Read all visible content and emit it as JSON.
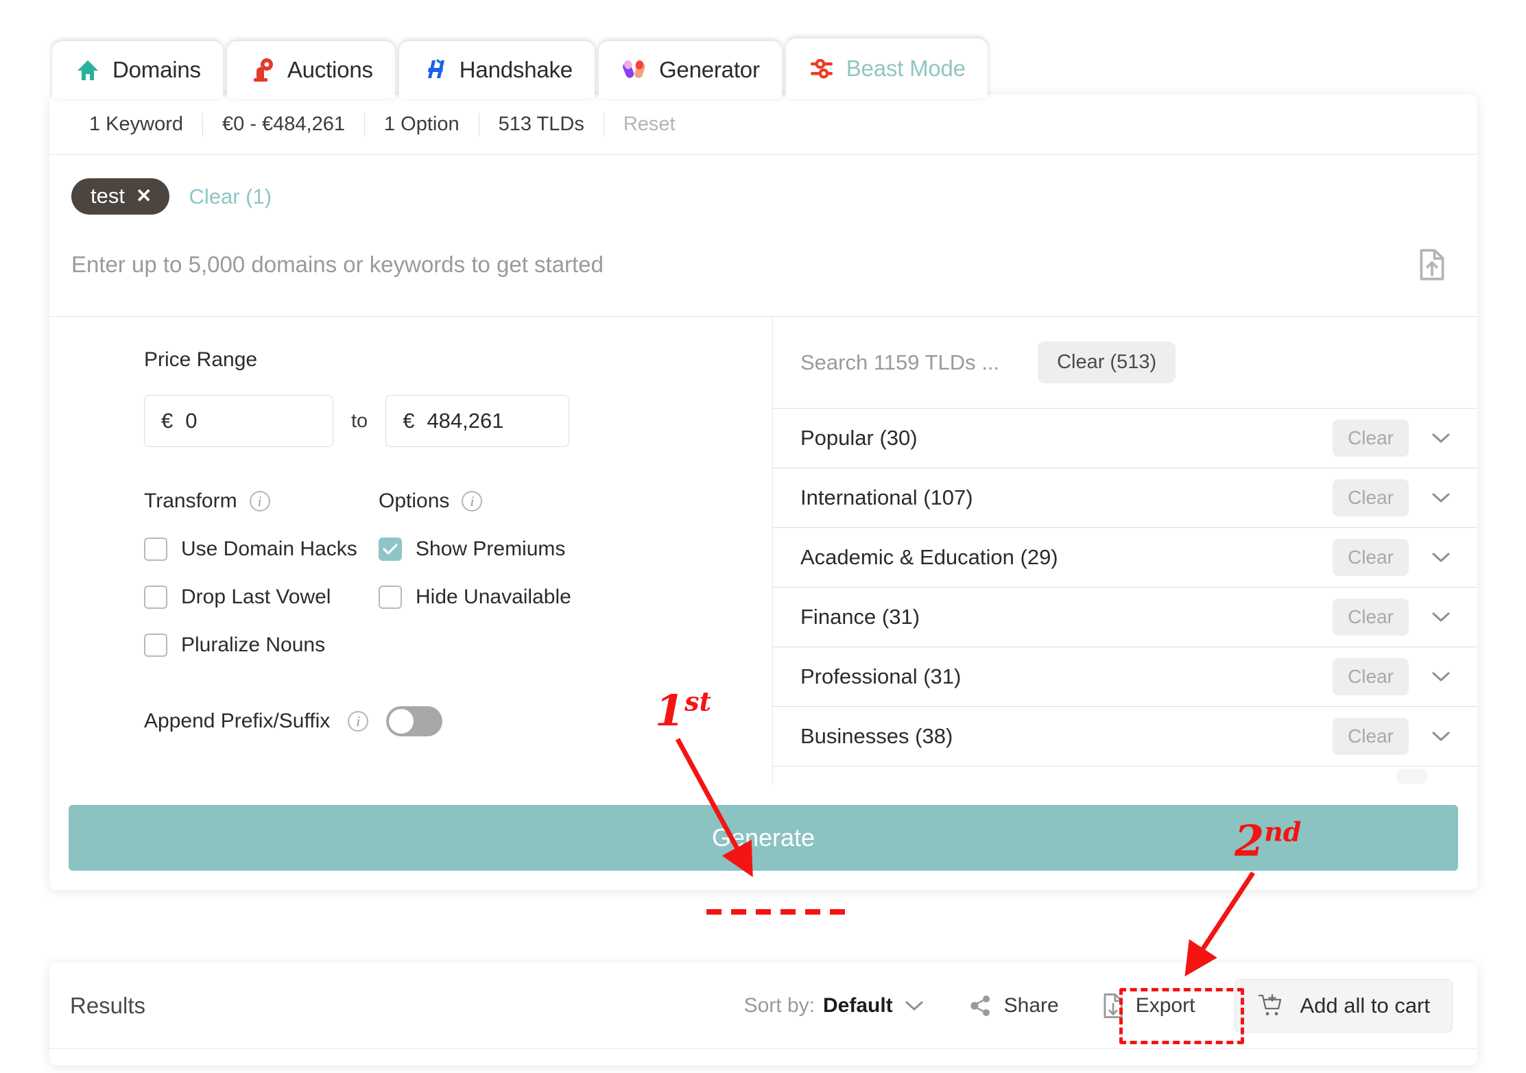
{
  "tabs": [
    {
      "label": "Domains",
      "icon": "house-icon",
      "active": false
    },
    {
      "label": "Auctions",
      "icon": "auction-gavel-icon",
      "active": false
    },
    {
      "label": "Handshake",
      "icon": "handshake-hns-icon",
      "active": false
    },
    {
      "label": "Generator",
      "icon": "generator-pills-icon",
      "active": false
    },
    {
      "label": "Beast Mode",
      "icon": "sliders-icon",
      "active": true
    }
  ],
  "summary": {
    "keywords": "1 Keyword",
    "price": "€0 - €484,261",
    "options": "1 Option",
    "tlds": "513 TLDs",
    "reset": "Reset"
  },
  "keywords": {
    "chips": [
      {
        "label": "test",
        "remove": "✕"
      }
    ],
    "clear_label": "Clear (1)",
    "input_placeholder": "Enter up to 5,000 domains or keywords to get started",
    "upload_icon": "file-upload-icon"
  },
  "price_range": {
    "title": "Price Range",
    "currency": "€",
    "min_value": "0",
    "max_value": "484,261",
    "to_label": "to"
  },
  "transform": {
    "title": "Transform",
    "info_icon": "info-icon",
    "items": [
      {
        "label": "Use Domain Hacks",
        "checked": false
      },
      {
        "label": "Drop Last Vowel",
        "checked": false
      },
      {
        "label": "Pluralize Nouns",
        "checked": false
      }
    ]
  },
  "options": {
    "title": "Options",
    "info_icon": "info-icon",
    "items": [
      {
        "label": "Show Premiums",
        "checked": true
      },
      {
        "label": "Hide Unavailable",
        "checked": false
      }
    ]
  },
  "append": {
    "label": "Append Prefix/Suffix",
    "info_icon": "info-icon",
    "enabled": false
  },
  "tld_panel": {
    "search_placeholder": "Search 1159 TLDs ...",
    "clear_all_label": "Clear (513)",
    "row_clear_label": "Clear",
    "chevron_icon": "chevron-down-icon",
    "categories": [
      {
        "label": "Popular (30)"
      },
      {
        "label": "International (107)"
      },
      {
        "label": "Academic & Education (29)"
      },
      {
        "label": "Finance (31)"
      },
      {
        "label": "Professional (31)"
      },
      {
        "label": "Businesses (38)"
      }
    ]
  },
  "generate": {
    "label": "Generate"
  },
  "results": {
    "title": "Results",
    "sort_label": "Sort by:",
    "sort_value": "Default",
    "sort_chevron_icon": "chevron-down-icon",
    "share_label": "Share",
    "share_icon": "share-nodes-icon",
    "export_label": "Export",
    "export_icon": "file-download-icon",
    "cart_label": "Add all to cart",
    "cart_icon": "cart-plus-icon"
  },
  "annotations": [
    {
      "id": "first",
      "number": "1",
      "ordinal": "st"
    },
    {
      "id": "second",
      "number": "2",
      "ordinal": "nd"
    }
  ],
  "colors": {
    "accent_teal": "#8bc3c2",
    "annotation_red": "#f41414",
    "chip_dark": "#4b443f",
    "domains_green": "#2ab09d",
    "auctions_red": "#e23b2a",
    "handshake_blue": "#1a62e8"
  }
}
